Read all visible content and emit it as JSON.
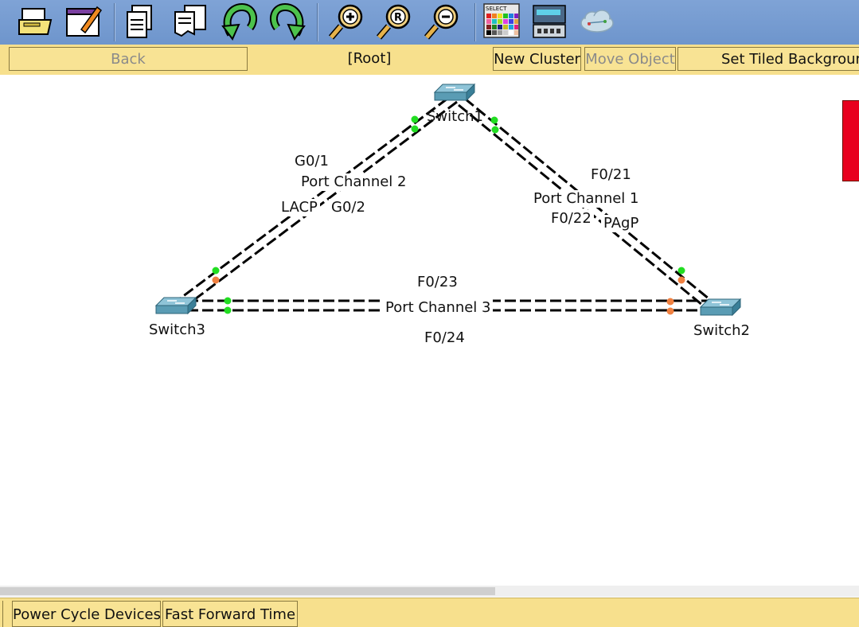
{
  "toolbar": {
    "icons": [
      "print-icon",
      "activity-wizard-icon",
      "copy-icon",
      "paste-icon",
      "undo-icon",
      "redo-icon",
      "zoom-in-icon",
      "zoom-reset-icon",
      "zoom-out-icon",
      "palette-icon",
      "device-template-icon",
      "cloud-icon"
    ],
    "palette_label": "SELECT"
  },
  "nav": {
    "back": "Back",
    "root": "[Root]",
    "new_cluster": "New Cluster",
    "move_object": "Move Object",
    "set_tiled_background": "Set Tiled Background"
  },
  "topology": {
    "devices": [
      {
        "name": "Switch1"
      },
      {
        "name": "Switch2"
      },
      {
        "name": "Switch3"
      }
    ],
    "labels": {
      "g0_1": "G0/1",
      "port_channel_2": "Port Channel 2",
      "lacp": "LACP",
      "g0_2": "G0/2",
      "f0_21": "F0/21",
      "port_channel_1": "Port Channel 1",
      "f0_22": "F0/22",
      "pagp": "PAgP",
      "f0_23": "F0/23",
      "port_channel_3": "Port Channel 3",
      "f0_24": "F0/24"
    },
    "colors": {
      "link_up": "#22dd22",
      "link_blocked": "#f08040",
      "switch_top": "#6fb0c8",
      "switch_side": "#3a7f98"
    }
  },
  "bottom": {
    "power_cycle": "Power Cycle Devices",
    "fast_forward": "Fast Forward Time"
  }
}
